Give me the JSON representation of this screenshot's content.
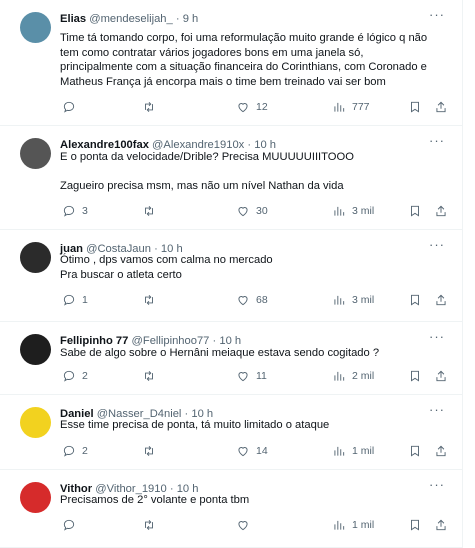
{
  "tweets": [
    {
      "name": "Elias",
      "handle": "@mendeselijah_",
      "dot": "·",
      "time": "9 h",
      "lines": [
        "Time tá tomando corpo, foi uma reformulação muito grande é lógico q não",
        "tem como contratar vários jogadores bons em uma janela só,",
        "principalmente com a situação financeira do Corinthians, com Coronado e",
        "Matheus França já encorpa mais o time bem treinado vai ser bom"
      ],
      "replies": "",
      "retweets": "",
      "likes": "12",
      "views": "777",
      "avatar_color": "#5a8fa8"
    },
    {
      "name": "Alexandre100fax",
      "handle": "@Alexandre1910x",
      "dot": "·",
      "time": "10 h",
      "lines": [
        "E o ponta da velocidade/Drible? Precisa MUUUUUIIITOOO",
        "",
        "Zagueiro precisa msm, mas não um nível Nathan da vida"
      ],
      "replies": "3",
      "retweets": "",
      "likes": "30",
      "views": "3 mil",
      "avatar_color": "#555555"
    },
    {
      "name": "juan",
      "handle": "@CostaJaun",
      "dot": "·",
      "time": "10 h",
      "lines": [
        "Ótimo , dps vamos com calma no mercado",
        "Pra buscar o atleta certo"
      ],
      "replies": "1",
      "retweets": "",
      "likes": "68",
      "views": "3 mil",
      "avatar_color": "#2b2b2b"
    },
    {
      "name": "Fellipinho 77",
      "handle": "@Fellipinhoo77",
      "dot": "·",
      "time": "10 h",
      "lines": [
        "Sabe de algo sobre o Hernâni meiaque  estava sendo cogitado ?"
      ],
      "replies": "2",
      "retweets": "",
      "likes": "11",
      "views": "2 mil",
      "avatar_color": "#1e1e1e"
    },
    {
      "name": "Daniel",
      "handle": "@Nasser_D4niel",
      "dot": "·",
      "time": "10 h",
      "lines": [
        "Esse time precisa de ponta, tá muito limitado o ataque"
      ],
      "replies": "2",
      "retweets": "",
      "likes": "14",
      "views": "1 mil",
      "avatar_color": "#f2d21f"
    },
    {
      "name": "Vithor",
      "handle": "@Vithor_1910",
      "dot": "·",
      "time": "10 h",
      "lines": [
        "Precisamos de 2° volante e ponta tbm"
      ],
      "replies": "",
      "retweets": "",
      "likes": "",
      "views": "1 mil",
      "avatar_color": "#d62b2b"
    }
  ],
  "icons": {
    "more": "more-dots-icon",
    "reply": "reply-icon",
    "retweet": "retweet-icon",
    "like": "heart-icon",
    "views": "views-icon",
    "bookmark": "bookmark-icon",
    "share": "share-icon"
  }
}
